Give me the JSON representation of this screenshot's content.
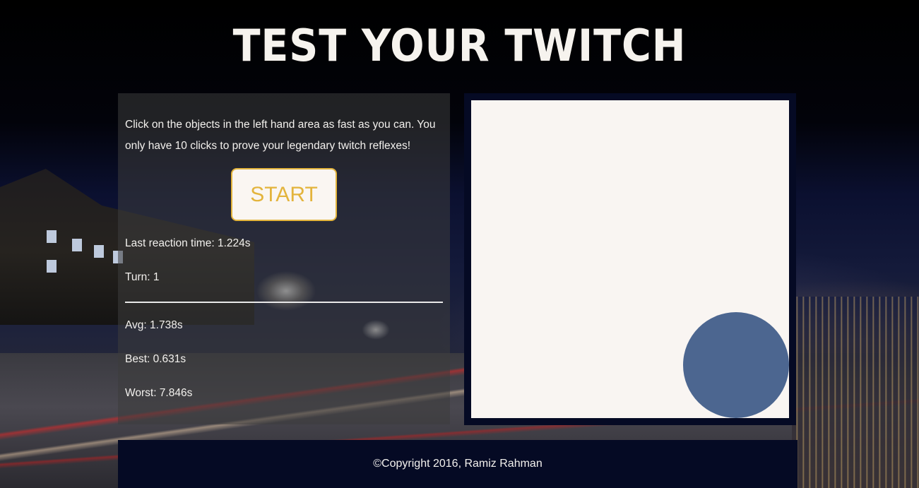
{
  "header": {
    "title": "TEST YOUR TWITCH"
  },
  "panel": {
    "instructions": "Click on the objects in the left hand area as fast as you can. You only have 10 clicks to prove your legendary twitch reflexes!",
    "start_label": "START",
    "last_reaction": "Last reaction time: 1.224s",
    "turn": "Turn: 1",
    "avg": "Avg: 1.738s",
    "best": "Best: 0.631s",
    "worst": "Worst: 7.846s"
  },
  "game": {
    "target_shape": "circle",
    "target_color": "#4c6690",
    "area_color": "#f9f5f2"
  },
  "footer": {
    "copyright": "©Copyright 2016, Ramiz Rahman"
  },
  "colors": {
    "accent": "#e3b43c",
    "frame": "#050a24"
  }
}
